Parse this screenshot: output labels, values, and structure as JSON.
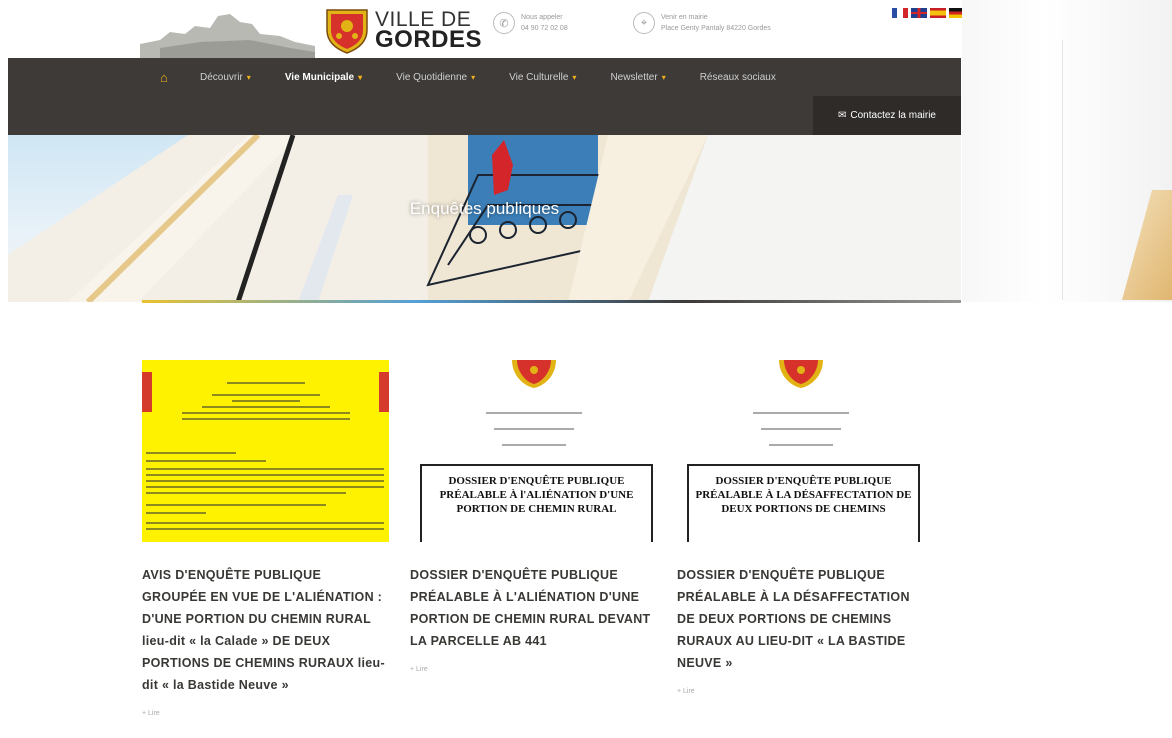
{
  "header": {
    "logo_line1": "VILLE DE",
    "logo_line2": "GORDES",
    "phone_label": "Nous appeler",
    "phone_value": "04 90 72 02 08",
    "address_label": "Venir en mairie",
    "address_value": "Place Genty Pantaly 84220 Gordes"
  },
  "flags": [
    "fr-flag",
    "uk-flag",
    "es-flag",
    "de-flag"
  ],
  "nav": {
    "items": [
      {
        "label": "Découvrir",
        "active": false,
        "dropdown": true
      },
      {
        "label": "Vie Municipale",
        "active": true,
        "dropdown": true
      },
      {
        "label": "Vie Quotidienne",
        "active": false,
        "dropdown": true
      },
      {
        "label": "Vie Culturelle",
        "active": false,
        "dropdown": true
      },
      {
        "label": "Newsletter",
        "active": false,
        "dropdown": true
      },
      {
        "label": "Réseaux sociaux",
        "active": false,
        "dropdown": false
      }
    ],
    "contact_label": "Contactez la mairie"
  },
  "hero": {
    "title": "Enquêtes publiques"
  },
  "cards": [
    {
      "title": "AVIS D'ENQUÊTE PUBLIQUE GROUPÉE EN VUE DE L'ALIÉNATION : D'UNE PORTION DU CHEMIN RURAL lieu-dit « la Calade » DE DEUX PORTIONS DE CHEMINS RURAUX lieu-dit « la Bastide Neuve »",
      "more": "+ Lire"
    },
    {
      "doc_title": "DOSSIER D'ENQUÊTE PUBLIQUE PRÉALABLE À l'ALIÉNATION D'UNE PORTION DE CHEMIN RURAL",
      "title": "DOSSIER D'ENQUÊTE PUBLIQUE PRÉALABLE À L'ALIÉNATION D'UNE PORTION DE CHEMIN RURAL DEVANT LA PARCELLE AB 441",
      "more": "+ Lire"
    },
    {
      "doc_title": "DOSSIER D'ENQUÊTE PUBLIQUE PRÉALABLE À LA DÉSAFFECTATION DE DEUX PORTIONS DE CHEMINS",
      "title": "DOSSIER D'ENQUÊTE PUBLIQUE PRÉALABLE À LA DÉSAFFECTATION DE DEUX PORTIONS DE CHEMINS RURAUX AU LIEU-DIT « LA BASTIDE NEUVE »",
      "more": "+ Lire"
    }
  ],
  "colors": {
    "nav_background": "#3d3a38",
    "accent": "#f2b21b",
    "card_title": "#3a3835",
    "yellow_notice": "#fff200"
  }
}
